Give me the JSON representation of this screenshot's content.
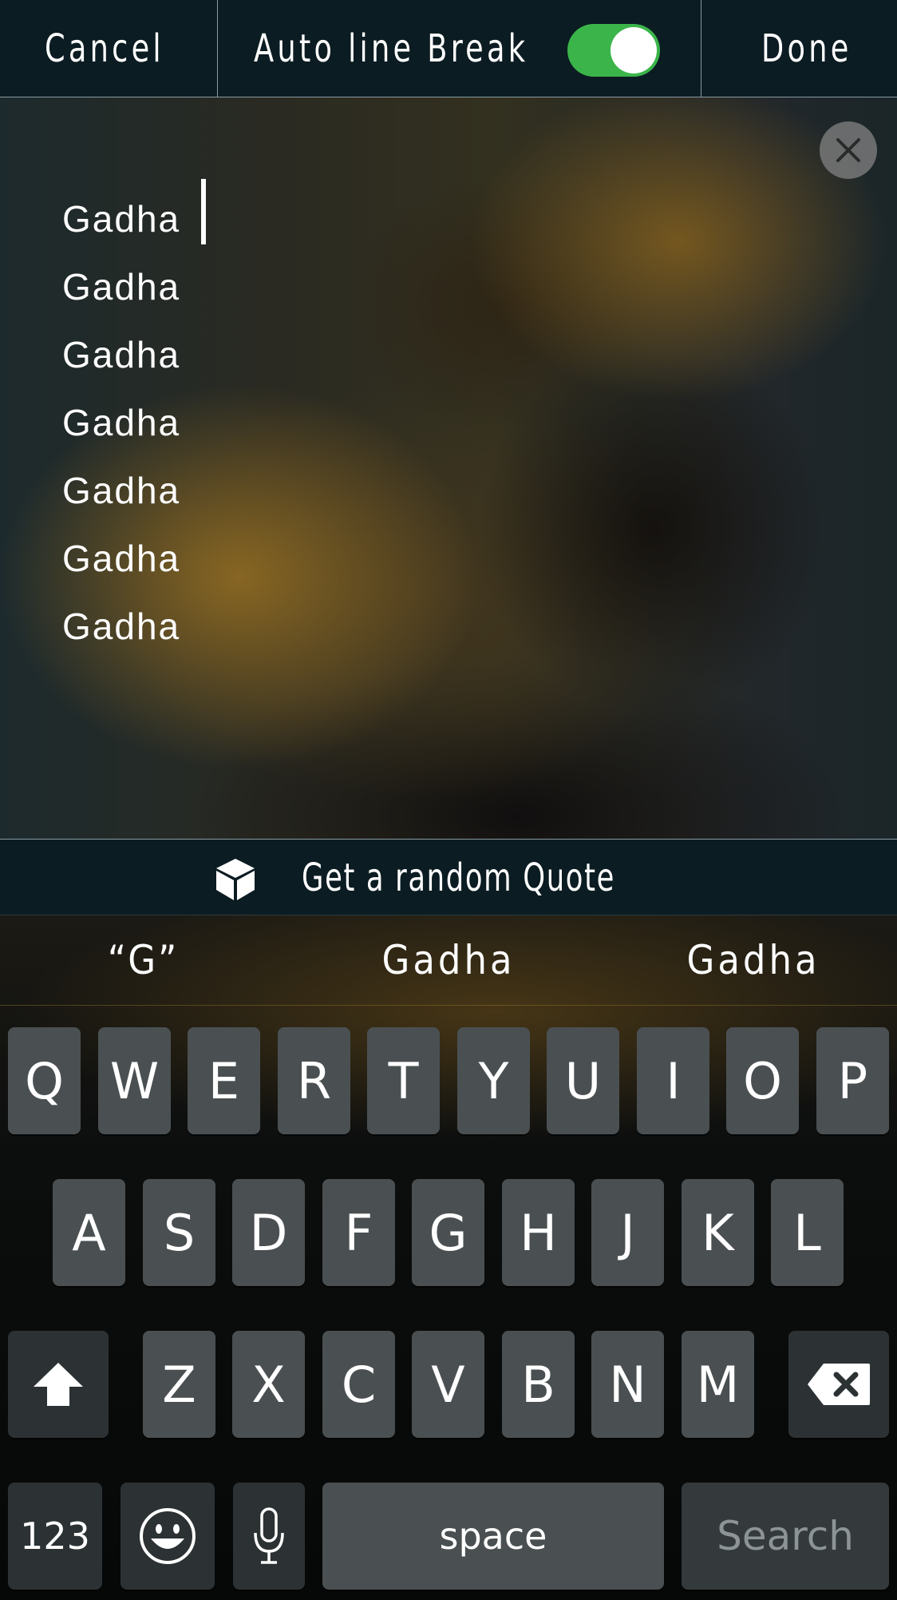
{
  "topbar": {
    "cancel_label": "Cancel",
    "auto_line_break_label": "Auto line Break",
    "auto_line_break_on": true,
    "done_label": "Done"
  },
  "editor": {
    "lines": [
      "Gadha",
      "Gadha",
      "Gadha",
      "Gadha",
      "Gadha",
      "Gadha",
      "Gadha"
    ],
    "close_icon": "close-icon"
  },
  "quote_bar": {
    "icon": "dice-icon",
    "label": "Get a random Quote"
  },
  "keyboard": {
    "suggestions": [
      "“G”",
      "Gadha",
      "Gadha"
    ],
    "row1": [
      "Q",
      "W",
      "E",
      "R",
      "T",
      "Y",
      "U",
      "I",
      "O",
      "P"
    ],
    "row2": [
      "A",
      "S",
      "D",
      "F",
      "G",
      "H",
      "J",
      "K",
      "L"
    ],
    "row3": [
      "Z",
      "X",
      "C",
      "V",
      "B",
      "N",
      "M"
    ],
    "numbers_label": "123",
    "space_label": "space",
    "search_label": "Search",
    "shift_icon": "shift-icon",
    "delete_icon": "backspace-icon",
    "emoji_icon": "emoji-icon",
    "mic_icon": "microphone-icon"
  },
  "colors": {
    "toggle_on": "#3bb54a",
    "bar_bg": "#0b1c22",
    "key_bg": "#4a5052"
  }
}
